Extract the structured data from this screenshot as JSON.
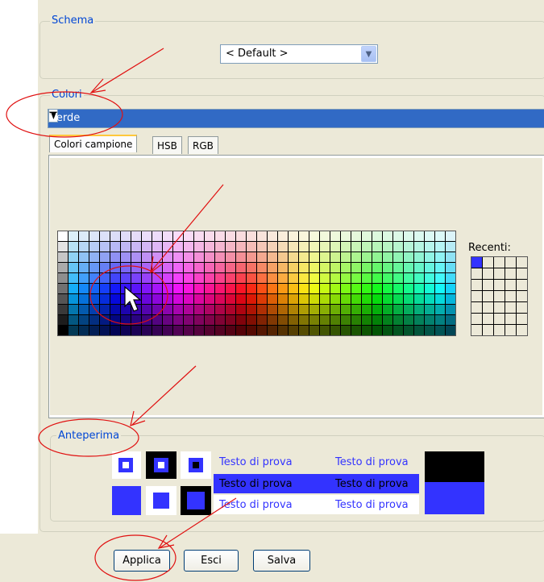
{
  "schema": {
    "legend": "Schema",
    "selected": "< Default >"
  },
  "colors": {
    "legend": "Colori",
    "selected": "Verde"
  },
  "tabs": [
    "Colori campione",
    "HSB",
    "RGB"
  ],
  "recent": {
    "label": "Recenti:"
  },
  "preview": {
    "legend": "Anteperima",
    "sample_text": "Testo di prova"
  },
  "buttons": {
    "apply": "Applica",
    "exit": "Esci",
    "save": "Salva"
  },
  "accent": "#3333ff"
}
